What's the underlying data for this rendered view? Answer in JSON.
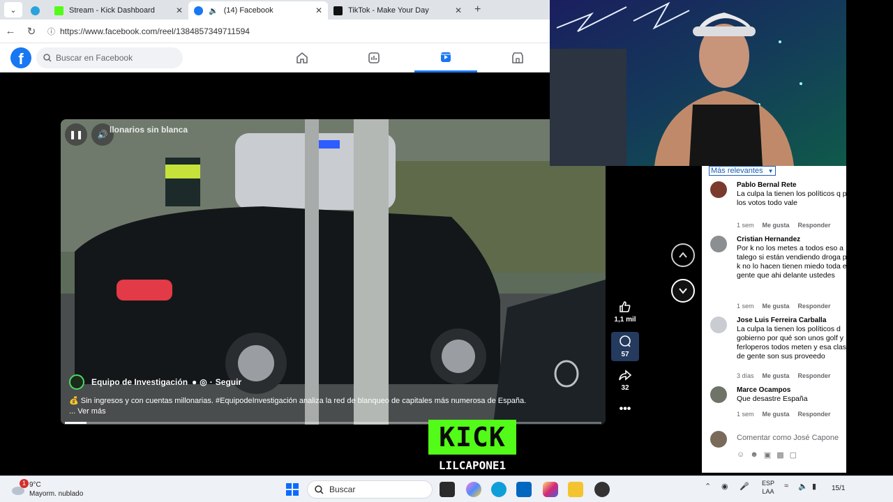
{
  "browser": {
    "tabs": [
      {
        "title": "",
        "icon": "telegram-icon"
      },
      {
        "title": "Stream - Kick Dashboard",
        "icon": "kick-icon"
      },
      {
        "title": "(14) Facebook",
        "icon": "facebook-icon",
        "active": true
      },
      {
        "title": "TikTok - Make Your Day",
        "icon": "tiktok-icon"
      }
    ],
    "url": "https://www.facebook.com/reel/1384857349711594"
  },
  "facebook": {
    "logo": "f",
    "search_placeholder": "Buscar en Facebook",
    "nav": [
      "home-icon",
      "feed-icon",
      "reels-icon",
      "marketplace-icon"
    ],
    "active_nav": "reels-icon"
  },
  "reel": {
    "overlay_title": "llonarios sin blanca",
    "author": "Equipo de Investigación",
    "follow": "Seguir",
    "caption": "Sin ingresos y con cuentas millonarias. #EquipodeInvestigación analiza la red de blanqueo de capitales más numerosa de España.",
    "more": "... Ver más",
    "progress": 0.04,
    "likes": "1,1 mil",
    "comments": "57",
    "shares": "32"
  },
  "comments": {
    "sort": "Más relevantes",
    "items": [
      {
        "name": "Pablo Bernal Rete",
        "text": "La culpa la tienen los políticos q por los votos todo vale",
        "time": "1 sem",
        "like": "Me gusta",
        "reply": "Responder",
        "avatar_color": "#7a3b2e"
      },
      {
        "name": "Cristian Hernandez",
        "text": "Por k no los metes a todos eso a talego si están vendiendo droga por k no lo hacen tienen miedo toda esa gente que ahi delante ustedes",
        "time": "1 sem",
        "like": "Me gusta",
        "reply": "Responder",
        "avatar_color": "#8c8f92"
      },
      {
        "name": "Jose Luis Ferreira Carballa",
        "text": "La culpa la tienen los políticos d gobierno por qué son unos golf y ferloperos todos meten y esa clase de gente son sus proveedo",
        "time": "3 días",
        "like": "Me gusta",
        "reply": "Responder",
        "avatar_color": "#c9cdd2"
      },
      {
        "name": "Marce Ocampos",
        "text": "Que desastre España",
        "time": "1 sem",
        "like": "Me gusta",
        "reply": "Responder",
        "avatar_color": "#6e7468"
      }
    ],
    "compose_placeholder": "Comentar como José Capone"
  },
  "stream": {
    "brand": "KICK",
    "username": "LILCAPONE1",
    "brand_color": "#53fc18"
  },
  "taskbar": {
    "temp": "9°C",
    "weather": "Mayorm. nublado",
    "weather_badge": "1",
    "search_placeholder": "Buscar",
    "lang_top": "ESP",
    "lang_bottom": "LAA",
    "clock": "15/1"
  }
}
